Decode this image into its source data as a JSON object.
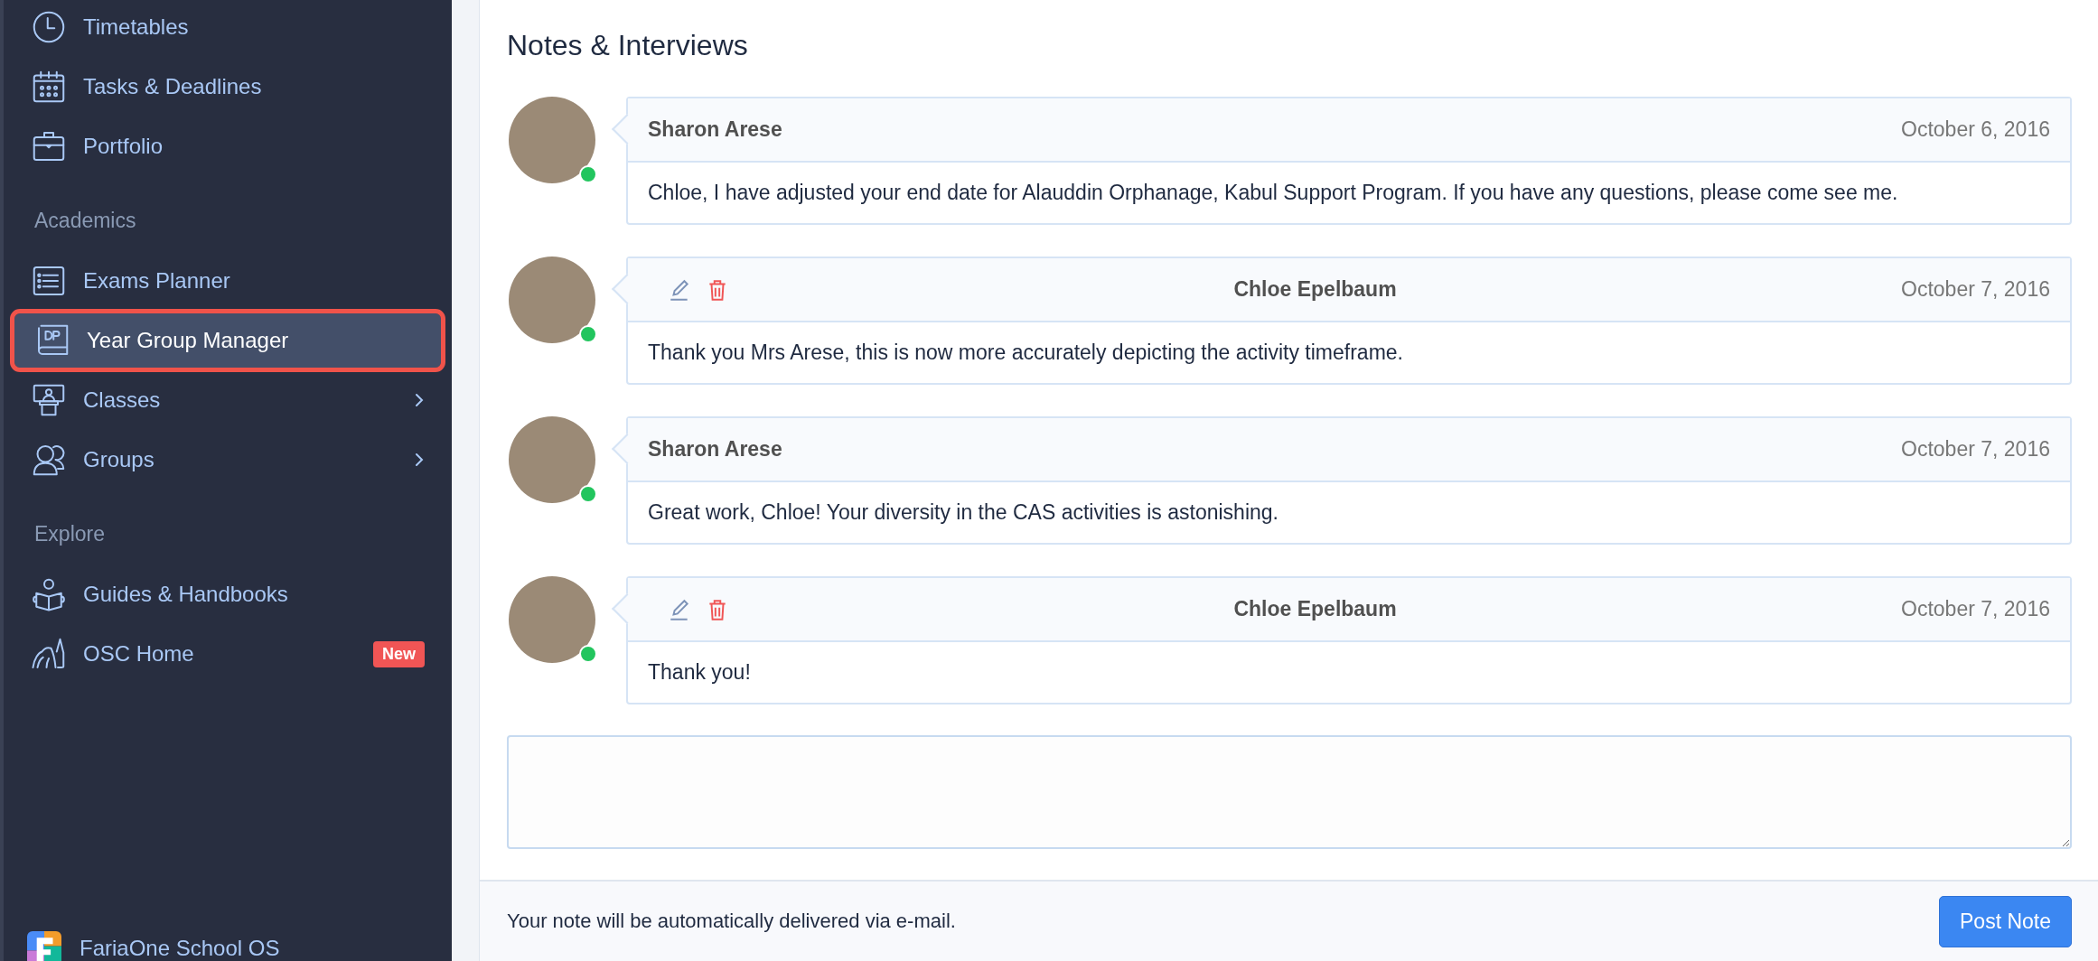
{
  "sidebar": {
    "items": [
      {
        "kind": "link",
        "label": "Timetables",
        "selected": false
      },
      {
        "kind": "link",
        "label": "Tasks & Deadlines",
        "selected": false
      },
      {
        "kind": "link",
        "label": "Portfolio",
        "selected": false
      },
      {
        "kind": "header",
        "label": "Academics"
      },
      {
        "kind": "link",
        "label": "Exams Planner",
        "selected": false
      },
      {
        "kind": "link",
        "label": "Year Group Manager",
        "selected": true
      },
      {
        "kind": "link",
        "label": "Classes",
        "selected": false,
        "expandable": true
      },
      {
        "kind": "link",
        "label": "Groups",
        "selected": false,
        "expandable": true
      },
      {
        "kind": "header",
        "label": "Explore"
      },
      {
        "kind": "link",
        "label": "Guides & Handbooks",
        "selected": false
      },
      {
        "kind": "link",
        "label": "OSC Home",
        "selected": false,
        "badge": "New"
      }
    ],
    "brand": "FariaOne School OS"
  },
  "notes": {
    "title": "Notes & Interviews",
    "items": [
      {
        "kind": "other",
        "author": "Sharon Arese",
        "date": "October 6, 2016",
        "text": "Chloe, I have adjusted your end date for Alauddin Orphanage, Kabul Support Program. If you have any questions, please come see me.",
        "online": true
      },
      {
        "kind": "own",
        "author": "Chloe Epelbaum",
        "date": "October 7, 2016",
        "text": "Thank you Mrs Arese, this is now more accurately depicting the activity timeframe.",
        "online": true
      },
      {
        "kind": "other",
        "author": "Sharon Arese",
        "date": "October 7, 2016",
        "text": "Great work, Chloe! Your diversity in the CAS activities is astonishing.",
        "online": true
      },
      {
        "kind": "own",
        "author": "Chloe Epelbaum",
        "date": "October 7, 2016",
        "text": "Thank you!",
        "online": true
      }
    ]
  },
  "footer": {
    "hint": "Your note will be automatically delivered via e-mail.",
    "button": "Post Note"
  }
}
